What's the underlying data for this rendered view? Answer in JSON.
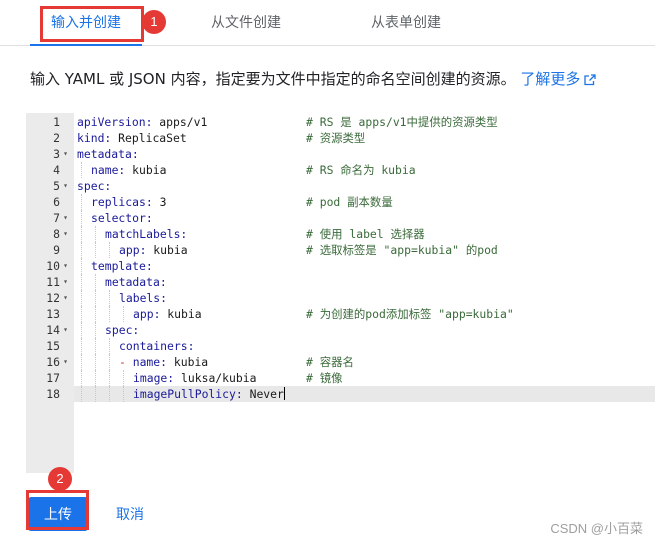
{
  "tabs": [
    {
      "label": "输入并创建",
      "active": true
    },
    {
      "label": "从文件创建",
      "active": false
    },
    {
      "label": "从表单创建",
      "active": false
    }
  ],
  "badges": [
    "1",
    "2"
  ],
  "description": {
    "text": "输入 YAML 或 JSON 内容，指定要为文件中指定的命名空间创建的资源。",
    "link": "了解更多"
  },
  "editor": {
    "lines": [
      {
        "num": "1",
        "fold": false,
        "indent": 0,
        "dash": false,
        "key": "apiVersion:",
        "value": " apps/v1",
        "comment": "# RS 是 apps/v1中提供的资源类型"
      },
      {
        "num": "2",
        "fold": false,
        "indent": 0,
        "dash": false,
        "key": "kind:",
        "value": " ReplicaSet",
        "comment": "# 资源类型"
      },
      {
        "num": "3",
        "fold": true,
        "indent": 0,
        "dash": false,
        "key": "metadata:",
        "value": "",
        "comment": ""
      },
      {
        "num": "4",
        "fold": false,
        "indent": 1,
        "dash": false,
        "key": "name:",
        "value": " kubia",
        "comment": "# RS 命名为 kubia"
      },
      {
        "num": "5",
        "fold": true,
        "indent": 0,
        "dash": false,
        "key": "spec:",
        "value": "",
        "comment": ""
      },
      {
        "num": "6",
        "fold": false,
        "indent": 1,
        "dash": false,
        "key": "replicas:",
        "value": " 3",
        "comment": "# pod 副本数量"
      },
      {
        "num": "7",
        "fold": true,
        "indent": 1,
        "dash": false,
        "key": "selector:",
        "value": "",
        "comment": ""
      },
      {
        "num": "8",
        "fold": true,
        "indent": 2,
        "dash": false,
        "key": "matchLabels:",
        "value": "",
        "comment": "# 使用 label 选择器"
      },
      {
        "num": "9",
        "fold": false,
        "indent": 3,
        "dash": false,
        "key": "app:",
        "value": " kubia",
        "comment": "# 选取标签是 \"app=kubia\" 的pod"
      },
      {
        "num": "10",
        "fold": true,
        "indent": 1,
        "dash": false,
        "key": "template:",
        "value": "",
        "comment": ""
      },
      {
        "num": "11",
        "fold": true,
        "indent": 2,
        "dash": false,
        "key": "metadata:",
        "value": "",
        "comment": ""
      },
      {
        "num": "12",
        "fold": true,
        "indent": 3,
        "dash": false,
        "key": "labels:",
        "value": "",
        "comment": ""
      },
      {
        "num": "13",
        "fold": false,
        "indent": 4,
        "dash": false,
        "key": "app:",
        "value": " kubia",
        "comment": "# 为创建的pod添加标签 \"app=kubia\""
      },
      {
        "num": "14",
        "fold": true,
        "indent": 2,
        "dash": false,
        "key": "spec:",
        "value": "",
        "comment": ""
      },
      {
        "num": "15",
        "fold": false,
        "indent": 3,
        "dash": false,
        "key": "containers:",
        "value": "",
        "comment": ""
      },
      {
        "num": "16",
        "fold": true,
        "indent": 3,
        "dash": true,
        "key": "name:",
        "value": " kubia",
        "comment": "# 容器名"
      },
      {
        "num": "17",
        "fold": false,
        "indent": 4,
        "dash": false,
        "key": "image:",
        "value": " luksa/kubia",
        "comment": "# 镜像"
      },
      {
        "num": "18",
        "fold": false,
        "indent": 4,
        "dash": false,
        "key": "imagePullPolicy:",
        "value": " Never",
        "comment": "",
        "cursor": true
      }
    ]
  },
  "buttons": {
    "upload": "上传",
    "cancel": "取消"
  },
  "watermark": "CSDN @小百菜",
  "colors": {
    "accent": "#1a73e8",
    "annotation_red": "#e53935",
    "gutter": "#ebebeb"
  }
}
